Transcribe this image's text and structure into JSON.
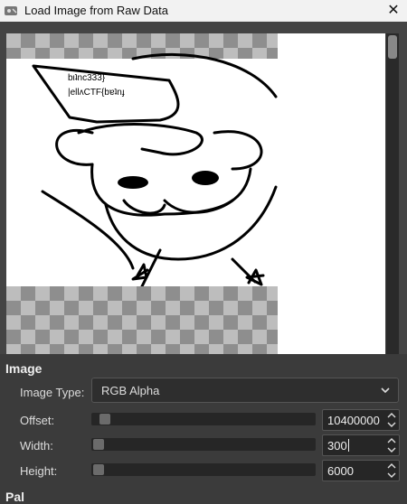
{
  "window": {
    "title": "Load Image from Raw Data",
    "close_glyph": "✕"
  },
  "preview": {
    "drawing_text_line1": "bιʇnc333}",
    "drawing_text_line2": "|ellʌCTF{bɐʇnɟ"
  },
  "image_section": {
    "heading": "Image"
  },
  "image_type": {
    "label": "Image Type:",
    "value": "RGB Alpha"
  },
  "offset": {
    "label": "Offset:",
    "value": "10400000",
    "level": 0.03
  },
  "width": {
    "label": "Width:",
    "value": "300",
    "level": 0.0
  },
  "height": {
    "label": "Height:",
    "value": "6000",
    "level": 0.0
  },
  "next_section_partial": {
    "text": "Pal"
  },
  "colors": {
    "accent": "#3b3b3b",
    "titlebar": "#f2f2f2"
  }
}
